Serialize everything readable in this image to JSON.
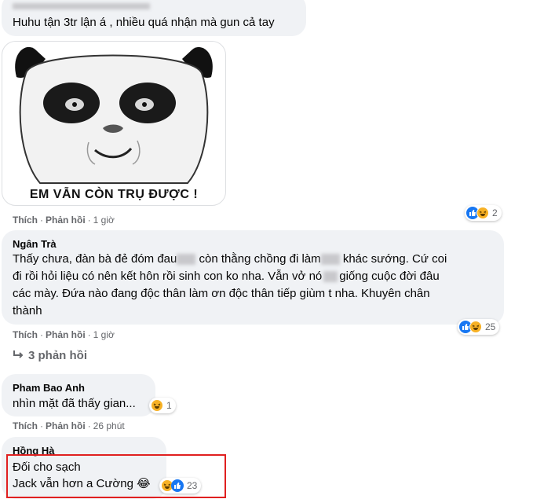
{
  "comments": {
    "c1": {
      "text": "Huhu tận 3tr lận á , nhiều quá nhận mà gun cả tay",
      "sticker_caption": "EM VẪN CÒN TRỤ ĐƯỢC !",
      "like_label": "Thích",
      "reply_label": "Phản hồi",
      "time": "1 giờ",
      "reaction_count": "2"
    },
    "c2": {
      "author": "Ngân Trà",
      "line1_a": "Thấy chưa, đàn bà đẻ đóm đau",
      "line1_b": "còn thằng chồng đi làm",
      "line1_c": "khác sướng. Cứ coi",
      "line2_a": "đi rồi hỏi liệu có nên kết hôn rồi sinh con ko nha. Vẫn vở nó",
      "line2_b": "giống cuộc đời đâu",
      "line3": "các mày. Đứa nào đang độc thân làm ơn độc thân tiếp giùm t nha. Khuyên chân",
      "line4": "thành",
      "like_label": "Thích",
      "reply_label": "Phản hồi",
      "time": "1 giờ",
      "reaction_count": "25",
      "replies_toggle": "3 phản hồi"
    },
    "c3": {
      "author": "Pham Bao Anh",
      "text": "nhìn mặt đã thấy gian...",
      "like_label": "Thích",
      "reply_label": "Phản hồi",
      "time": "26 phút",
      "reaction_count": "1"
    },
    "c4": {
      "author": "Hồng Hà",
      "line1": "Đối cho sạch",
      "line2": "Jack vẫn hơn a Cường",
      "emoji": "😂",
      "reaction_count": "23"
    }
  },
  "colors": {
    "bubble": "#f0f2f5",
    "like_blue": "#1877f2",
    "haha_yellow": "#f7b125",
    "highlight_red": "#e02020",
    "muted": "#65676b"
  }
}
